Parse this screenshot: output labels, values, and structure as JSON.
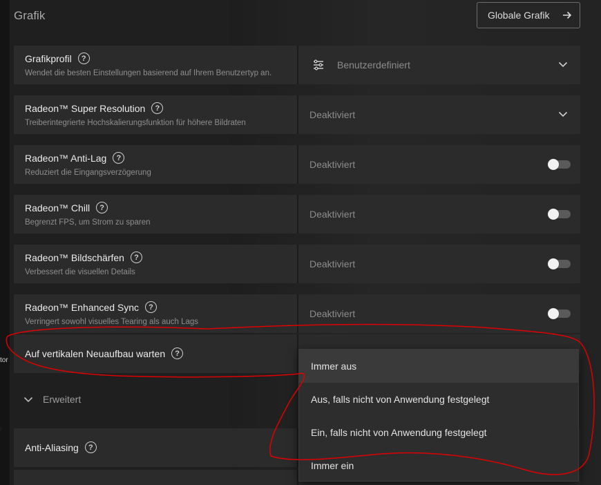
{
  "background_fragments": [
    "tor",
    "r"
  ],
  "header": {
    "title": "Grafik",
    "global_button_label": "Globale Grafik"
  },
  "settings": [
    {
      "title": "Grafikprofil",
      "description": "Wendet die besten Einstellungen basierend auf Ihrem Benutzertyp an.",
      "value": "Benutzerdefiniert",
      "control": "dropdown",
      "icon": "list-settings-icon"
    },
    {
      "title": "Radeon™ Super Resolution",
      "description": "Treiberintegrierte Hochskalierungsfunktion für höhere Bildraten",
      "value": "Deaktiviert",
      "control": "dropdown"
    },
    {
      "title": "Radeon™ Anti-Lag",
      "description": "Reduziert die Eingangsverzögerung",
      "value": "Deaktiviert",
      "control": "toggle",
      "enabled": false
    },
    {
      "title": "Radeon™ Chill",
      "description": "Begrenzt FPS, um Strom zu sparen",
      "value": "Deaktiviert",
      "control": "toggle",
      "enabled": false
    },
    {
      "title": "Radeon™ Bildschärfen",
      "description": "Verbessert die visuellen Details",
      "value": "Deaktiviert",
      "control": "toggle",
      "enabled": false
    },
    {
      "title": "Radeon™ Enhanced Sync",
      "description": "Verringert sowohl visuelles Tearing als auch Lags",
      "value": "Deaktiviert",
      "control": "toggle",
      "enabled": false
    },
    {
      "title": "Auf vertikalen Neuaufbau warten",
      "control": "dropdown-open"
    }
  ],
  "advanced": {
    "label": "Erweitert",
    "items": [
      {
        "title": "Anti-Aliasing"
      }
    ]
  },
  "vsync_dropdown": {
    "options": [
      "Immer aus",
      "Aus, falls nicht von Anwendung festgelegt",
      "Ein, falls nicht von Anwendung festgelegt",
      "Immer ein"
    ],
    "highlighted": "Immer aus"
  },
  "colors": {
    "background": "#1f1f1f",
    "row": "#2b2b2b",
    "annotation": "#e00000"
  }
}
